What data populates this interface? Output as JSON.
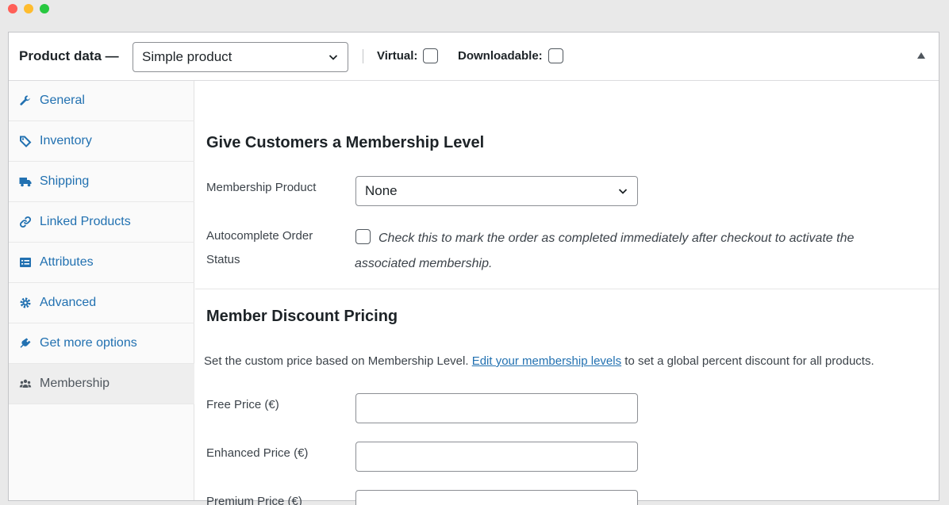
{
  "header": {
    "title": "Product data —",
    "product_type": "Simple product",
    "virtual_label": "Virtual:",
    "virtual_checked": false,
    "downloadable_label": "Downloadable:",
    "downloadable_checked": false
  },
  "tabs": [
    {
      "label": "General",
      "icon": "wrench-icon"
    },
    {
      "label": "Inventory",
      "icon": "tag-icon"
    },
    {
      "label": "Shipping",
      "icon": "truck-icon"
    },
    {
      "label": "Linked Products",
      "icon": "link-icon"
    },
    {
      "label": "Attributes",
      "icon": "list-icon"
    },
    {
      "label": "Advanced",
      "icon": "gear-icon"
    },
    {
      "label": "Get more options",
      "icon": "plugin-icon"
    },
    {
      "label": "Membership",
      "icon": "users-icon",
      "active": true
    }
  ],
  "membership": {
    "section_title": "Give Customers a Membership Level",
    "product_label": "Membership Product",
    "product_value": "None",
    "autocomplete_label_line1": "Autocomplete Order",
    "autocomplete_label_line2": "Status",
    "autocomplete_checked": false,
    "autocomplete_desc": "Check this to mark the order as completed immediately after checkout to activate the associated membership."
  },
  "discount": {
    "section_title": "Member Discount Pricing",
    "note_before": "Set the custom price based on Membership Level.",
    "note_link": "Edit your membership levels",
    "note_after": "to set a global percent discount for all products.",
    "fields": [
      {
        "label": "Free Price (€)",
        "value": ""
      },
      {
        "label": "Enhanced Price (€)",
        "value": ""
      },
      {
        "label": "Premium Price (€)",
        "value": ""
      }
    ]
  },
  "colors": {
    "link": "#2271b1",
    "text": "#1d2327",
    "border": "#8c8f94"
  }
}
